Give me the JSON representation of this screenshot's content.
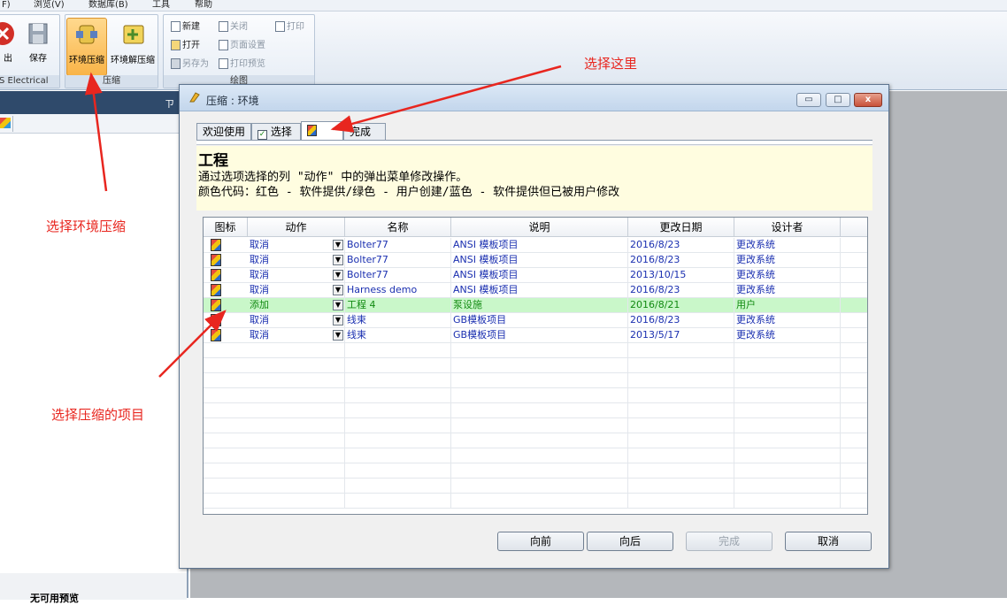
{
  "menu": {
    "items": [
      "F)",
      "浏览(V)",
      "数据库(B)",
      "工具",
      "帮助"
    ]
  },
  "ribbon": {
    "exit_label": "出",
    "save_label": "保存",
    "brand_label": "S Electrical",
    "compress_label": "环境压缩",
    "decompress_label": "环境解压缩",
    "compress_group_label": "压缩",
    "draw_group_label": "绘图",
    "new_label": "新建",
    "open_label": "打开",
    "saveas_label": "另存为",
    "close_label": "关闭",
    "pagesetup_label": "页面设置",
    "printpreview_label": "打印预览",
    "print_label": "打印"
  },
  "left_panel": {
    "pin_symbol": "ㄗ",
    "preview_label": "无可用预览"
  },
  "dialog": {
    "title": "压缩 : 环境",
    "tabs": {
      "welcome": "欢迎使用",
      "select": "选择",
      "finish": "完成"
    },
    "heading": "工程",
    "info_line1": "通过选项选择的列 \"动作\" 中的弹出菜单修改操作。",
    "info_line2": "颜色代码：红色 - 软件提供/绿色 - 用户创建/蓝色 - 软件提供但已被用户修改",
    "columns": {
      "icon": "图标",
      "action": "动作",
      "name": "名称",
      "description": "说明",
      "modified": "更改日期",
      "designer": "设计者"
    },
    "rows": [
      {
        "action": "取消",
        "name": "Bolter77",
        "description": "ANSI 模板项目",
        "date": "2016/8/23",
        "designer": "更改系统",
        "color": "blue"
      },
      {
        "action": "取消",
        "name": "Bolter77",
        "description": "ANSI 模板项目",
        "date": "2016/8/23",
        "designer": "更改系统",
        "color": "blue"
      },
      {
        "action": "取消",
        "name": "Bolter77",
        "description": "ANSI 模板项目",
        "date": "2013/10/15",
        "designer": "更改系统",
        "color": "blue"
      },
      {
        "action": "取消",
        "name": "Harness demo",
        "description": "ANSI 模板项目",
        "date": "2016/8/23",
        "designer": "更改系统",
        "color": "blue"
      },
      {
        "action": "添加",
        "name": "工程 4",
        "description": "泵设施",
        "date": "2016/8/21",
        "designer": "用户",
        "color": "green"
      },
      {
        "action": "取消",
        "name": "线束",
        "description": "GB模板项目",
        "date": "2016/8/23",
        "designer": "更改系统",
        "color": "blue"
      },
      {
        "action": "取消",
        "name": "线束",
        "description": "GB模板项目",
        "date": "2013/5/17",
        "designer": "更改系统",
        "color": "blue"
      }
    ],
    "buttons": {
      "back": "向前",
      "next": "向后",
      "finish": "完成",
      "cancel": "取消"
    },
    "window_buttons": {
      "minimize": "▭",
      "maximize": "□",
      "close": "x"
    }
  },
  "annotations": {
    "select_here": "选择这里",
    "select_compress": "选择环境压缩",
    "select_items": "选择压缩的项目"
  },
  "colors": {
    "annotation": "#e8261f",
    "modified_blue": "#1a2fb0",
    "user_green": "#118a11",
    "added_row_bg": "#c9f7c9"
  }
}
